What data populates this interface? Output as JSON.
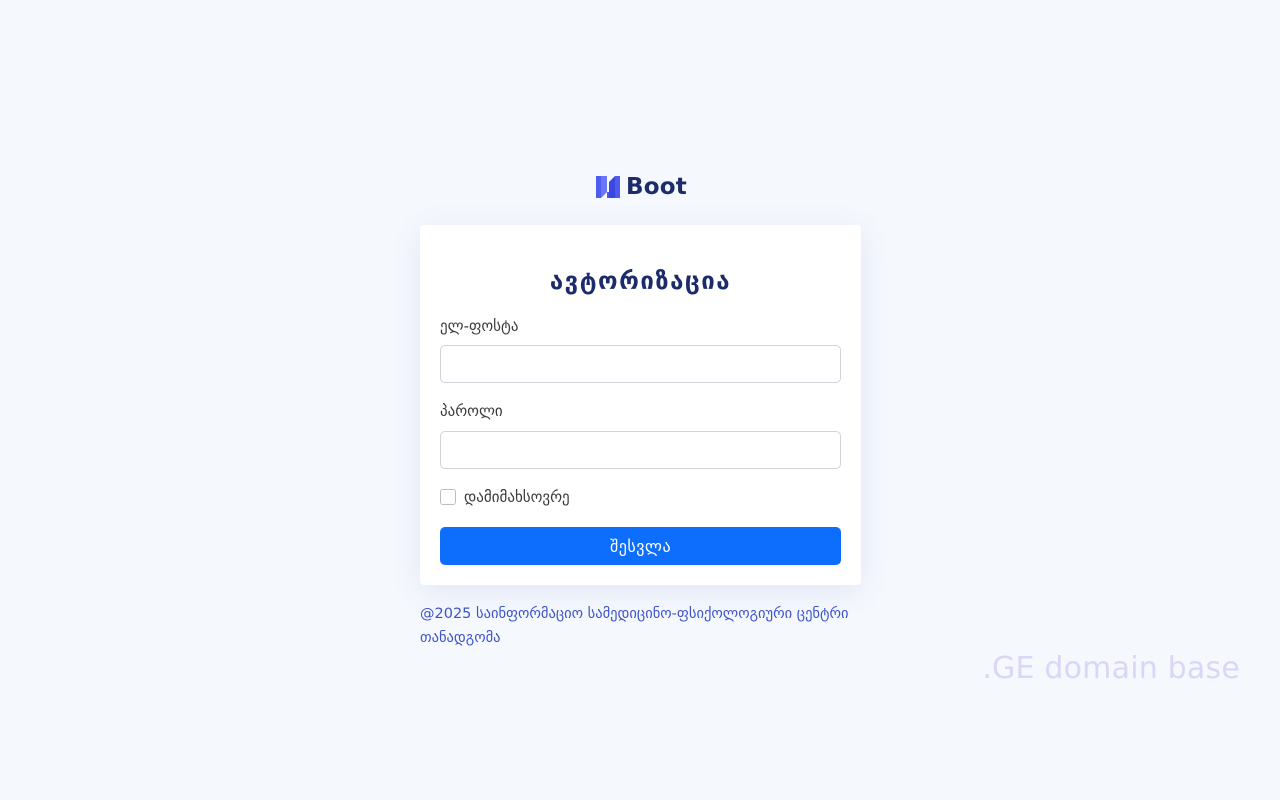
{
  "brand": {
    "name": "Boot",
    "logo_icon": "boot-logo-mark",
    "colors": {
      "mark": "#4d5bf0",
      "text": "#1c2b6b"
    }
  },
  "login_form": {
    "title": "ავტორიზაცია",
    "email_label": "ელ-ფოსტა",
    "email_value": "",
    "password_label": "პაროლი",
    "password_value": "",
    "remember_label": "დამიმახსოვრე",
    "remember_checked": false,
    "submit_label": "შესვლა"
  },
  "footer": {
    "text": "@2025 საინფორმაციო სამედიცინო-ფსიქოლოგიური ცენტრი თანადგომა"
  },
  "watermark": {
    "text": ".GE domain base"
  },
  "colors": {
    "background": "#f5f8fd",
    "accent": "#0d6efd",
    "footer_link": "#3d54c9"
  }
}
